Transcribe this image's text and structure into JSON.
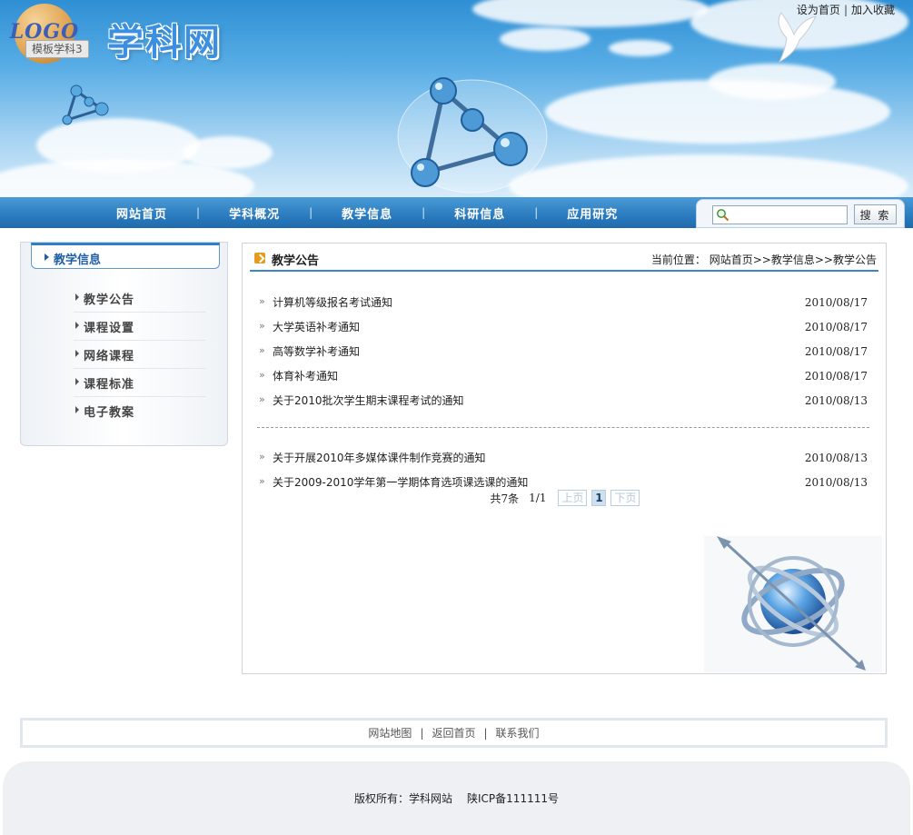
{
  "header": {
    "logo_text": "LOGO",
    "logo_tag": "模板学科3",
    "site_title": "学科网",
    "top_links": [
      "设为首页",
      "加入收藏"
    ]
  },
  "nav": {
    "items": [
      "网站首页",
      "学科概况",
      "教学信息",
      "科研信息",
      "应用研究"
    ],
    "search_placeholder": "",
    "search_button": "搜 索"
  },
  "sidebar": {
    "title": "教学信息",
    "items": [
      "教学公告",
      "课程设置",
      "网络课程",
      "课程标准",
      "电子教案"
    ]
  },
  "main": {
    "title": "教学公告",
    "breadcrumb_prefix": "当前位置：",
    "breadcrumb": [
      "网站首页",
      "教学信息",
      "教学公告"
    ],
    "breadcrumb_sep": ">>",
    "news_group1": [
      {
        "title": "计算机等级报名考试通知",
        "date": "2010/08/17"
      },
      {
        "title": "大学英语补考通知",
        "date": "2010/08/17"
      },
      {
        "title": "高等数学补考通知",
        "date": "2010/08/17"
      },
      {
        "title": "体育补考通知",
        "date": "2010/08/17"
      },
      {
        "title": "关于2010批次学生期末课程考试的通知",
        "date": "2010/08/13"
      }
    ],
    "news_group2": [
      {
        "title": "关于开展2010年多媒体课件制作竞赛的通知",
        "date": "2010/08/13"
      },
      {
        "title": "关于2009-2010学年第一学期体育选项课选课的通知",
        "date": "2010/08/13"
      }
    ],
    "pager": {
      "total": "共7条",
      "pages": "1/1",
      "prev": "上页",
      "current": "1",
      "next": "下页"
    }
  },
  "footer": {
    "links": [
      "网站地图",
      "返回首页",
      "联系我们"
    ],
    "copyright": "版权所有：学科网站",
    "icp": "陕ICP备111111号"
  }
}
